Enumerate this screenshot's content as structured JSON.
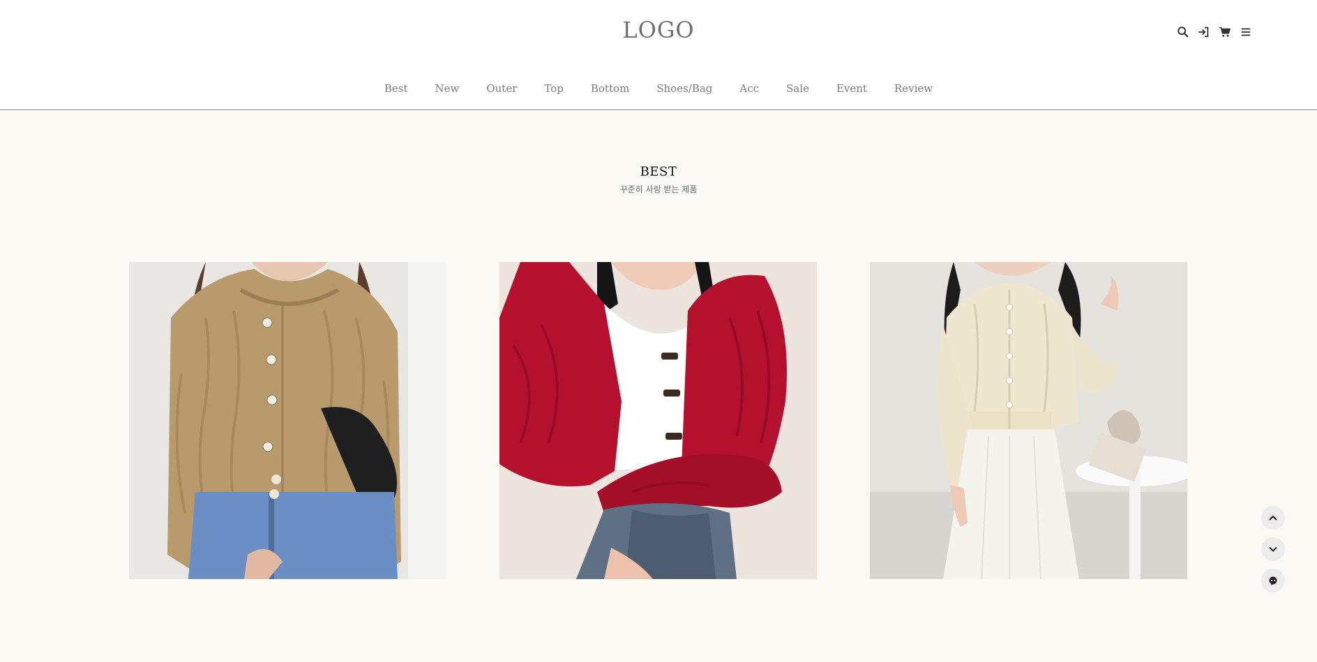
{
  "header": {
    "logo": "LOGO",
    "icons": [
      "search-icon",
      "login-icon",
      "cart-icon",
      "menu-icon"
    ]
  },
  "nav": {
    "items": [
      {
        "label": "Best"
      },
      {
        "label": "New"
      },
      {
        "label": "Outer"
      },
      {
        "label": "Top"
      },
      {
        "label": "Bottom"
      },
      {
        "label": "Shoes/Bag"
      },
      {
        "label": "Acc"
      },
      {
        "label": "Sale"
      },
      {
        "label": "Event"
      },
      {
        "label": "Review"
      }
    ]
  },
  "section": {
    "title": "BEST",
    "subtitle": "꾸준히 사랑 받는 제품"
  },
  "products": [
    {
      "image": "beige cable-knit cardigan",
      "color": "#b99a6c"
    },
    {
      "image": "red cable-knit cardigan",
      "color": "#b5112e"
    },
    {
      "image": "cream cable-knit cardigan",
      "color": "#eee6cf"
    }
  ],
  "floating_buttons": [
    "chevron-up-icon",
    "chevron-down-icon",
    "chat-icon"
  ],
  "colors": {
    "page_bg": "#fbf9f3",
    "header_bg": "#ffffff",
    "nav_text": "#7a7a7a",
    "logo_text": "#6e6e6e"
  }
}
